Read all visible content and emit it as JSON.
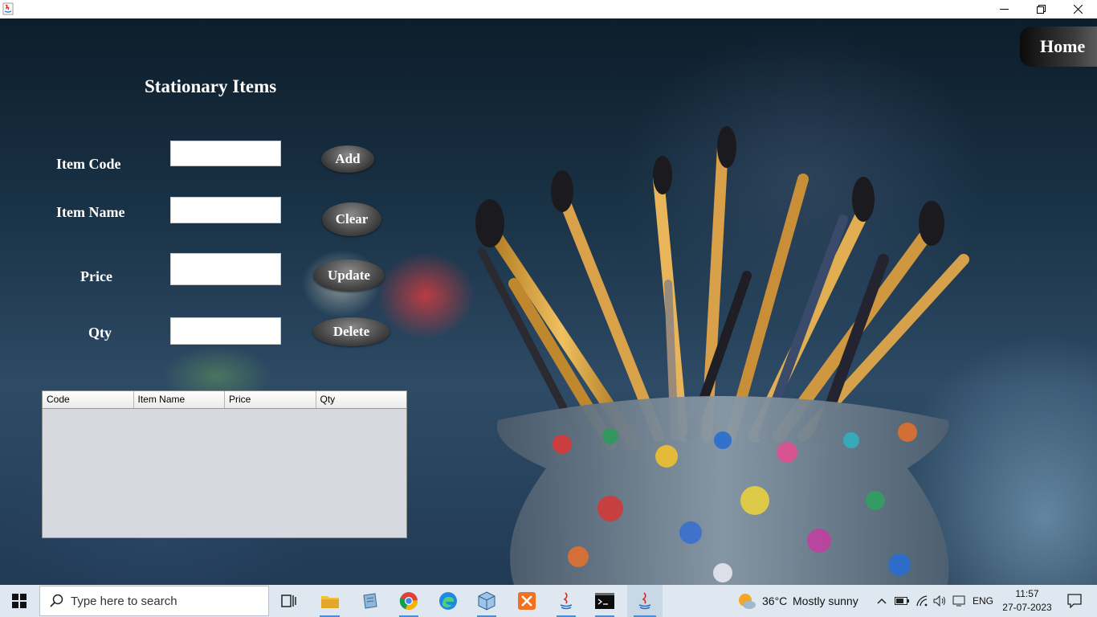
{
  "window": {
    "controls": [
      "minimize",
      "restore",
      "close"
    ]
  },
  "page": {
    "title": "Stationary Items",
    "home_label": "Home"
  },
  "form": {
    "item_code_label": "Item Code",
    "item_name_label": "Item Name",
    "price_label": "Price",
    "qty_label": "Qty",
    "item_code_value": "",
    "item_name_value": "",
    "price_value": "",
    "qty_value": ""
  },
  "buttons": {
    "add": "Add",
    "clear": "Clear",
    "update": "Update",
    "delete": "Delete"
  },
  "table": {
    "columns": [
      "Code",
      "Item Name",
      "Price",
      "Qty"
    ],
    "rows": []
  },
  "taskbar": {
    "search_placeholder": "Type here to search",
    "apps": [
      "start-icon",
      "task-view-icon",
      "file-explorer-icon",
      "notepad-icon",
      "chrome-icon",
      "edge-icon",
      "virtualbox-icon",
      "xampp-icon",
      "java-icon",
      "terminal-icon",
      "java-icon"
    ],
    "weather_temp": "36°C",
    "weather_text": "Mostly sunny",
    "language": "ENG",
    "time": "11:57",
    "date": "27-07-2023"
  },
  "colors": {
    "taskbar_bg": "#dfe8f0",
    "table_bg": "#d6d9e0",
    "accent": "#4a8fd6"
  }
}
